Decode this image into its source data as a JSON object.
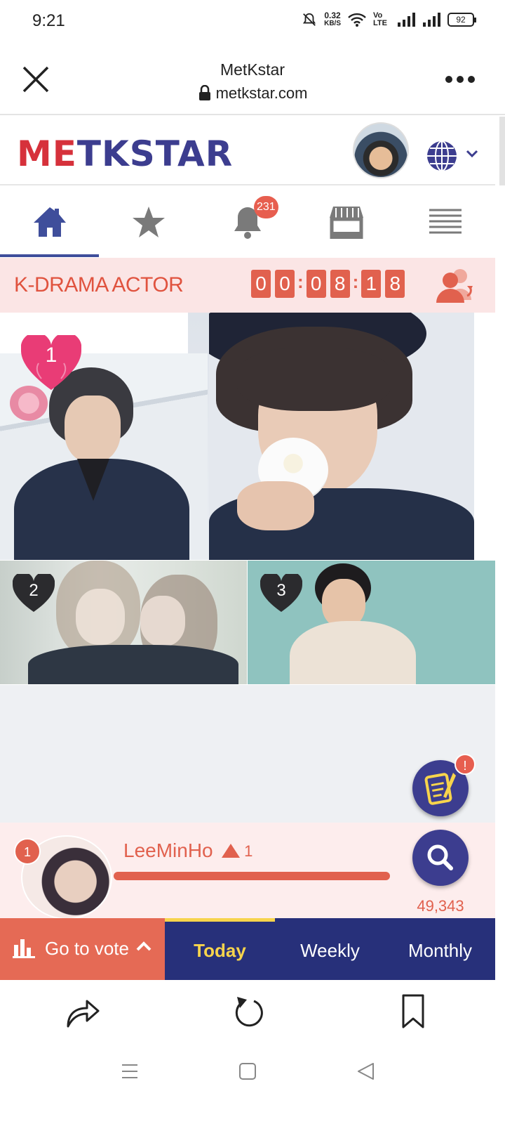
{
  "status_bar": {
    "time": "9:21",
    "net_speed": "0.32",
    "net_unit": "KB/S",
    "volte": "Vo LTE",
    "battery": "92"
  },
  "browser": {
    "title": "MetKstar",
    "url": "metkstar.com"
  },
  "site": {
    "logo_m": "M",
    "logo_e": "E",
    "logo_rest": "TKSTAR"
  },
  "nav": {
    "notification_count": "231"
  },
  "category": {
    "title": "K-DRAMA ACTOR",
    "timer_digits": [
      "0",
      "0",
      "0",
      "8",
      "1",
      "8"
    ]
  },
  "ranks": {
    "first": "1",
    "second": "2",
    "third": "3"
  },
  "quill_badge": "!",
  "leader": {
    "rank": "1",
    "name": "LeeMinHo",
    "change": "1",
    "score": "49,343"
  },
  "vote": {
    "go_label": "Go to vote",
    "tabs": [
      "Today",
      "Weekly",
      "Monthly"
    ]
  },
  "colors": {
    "brand_red": "#d6313b",
    "brand_navy": "#3c3d8f",
    "accent_coral": "#e1614e",
    "tab_bg": "#27307a",
    "active_yellow": "#f7d44c"
  }
}
